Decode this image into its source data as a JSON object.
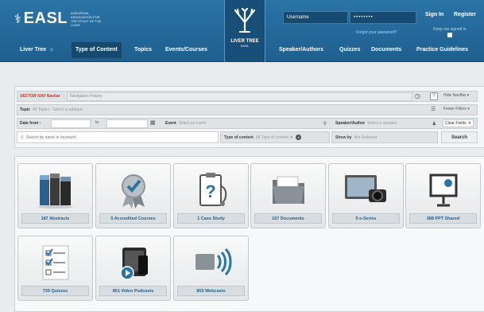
{
  "header": {
    "logo_mark": "⚕",
    "logo_text": "EASL",
    "logo_subtitle": "EUROPEAN ASSOCIATION FOR THE STUDY OF THE LIVER",
    "emblem_title": "LIVER TREE",
    "emblem_sub": "EASL",
    "username_placeholder": "Username",
    "password_placeholder": "••••••••",
    "signin_label": "Sign In",
    "register_label": "Register",
    "forgot_label": "Forgot your password?",
    "keep_label": "Keep me signed in",
    "nav": {
      "liver_tree": "Liver Tree",
      "type_of_content": "Type of Content",
      "topics": "Topics",
      "events": "Events/Courses",
      "speakers": "Speaker/Authors",
      "quizzes": "Quizzes",
      "documents": "Documents",
      "practice": "Practice Guidelines"
    }
  },
  "filters": {
    "nav_brand": "VECTOR NAV Navbar",
    "nav_history": "Navigation History",
    "hide_navbar": "Hide NavBar",
    "topic_label": "Topic",
    "topic_value": "All Topics - Select a subtopic",
    "fewer_filters": "Fewer Filters",
    "date_from_label": "Date from :",
    "to_label": "to",
    "event_label": "Event",
    "event_value": "Select an event",
    "speaker_label": "Speaker/Author",
    "speaker_value": "Select a speaker",
    "clear_fields": "Clear Fields",
    "search_placeholder": "Search by name or keyword...",
    "type_label": "Type of content",
    "type_value": "All Type of content",
    "show_by_label": "Show by",
    "show_by_value": "Not Selected",
    "search_button": "Search"
  },
  "tiles": [
    {
      "label": "187 Abstracts",
      "icon": "books-icon"
    },
    {
      "label": "5 Accredited Courses",
      "icon": "award-ribbon-icon"
    },
    {
      "label": "1 Case Study",
      "icon": "clipboard-stethoscope-icon"
    },
    {
      "label": "167 Documents",
      "icon": "folder-icon"
    },
    {
      "label": "5 e-Series",
      "icon": "monitor-camera-icon"
    },
    {
      "label": "388 PPT Shared",
      "icon": "presentation-screen-icon"
    },
    {
      "label": "739 Quizzes",
      "icon": "checklist-icon"
    },
    {
      "label": "851 Video Podcasts",
      "icon": "video-devices-icon"
    },
    {
      "label": "855 Webcasts",
      "icon": "webcast-icon"
    }
  ],
  "colors": {
    "header_blue": "#2a74a6",
    "nav_active": "#17496e",
    "tile_label_text": "#1f5f8f",
    "clear_x": "#c0392b"
  }
}
